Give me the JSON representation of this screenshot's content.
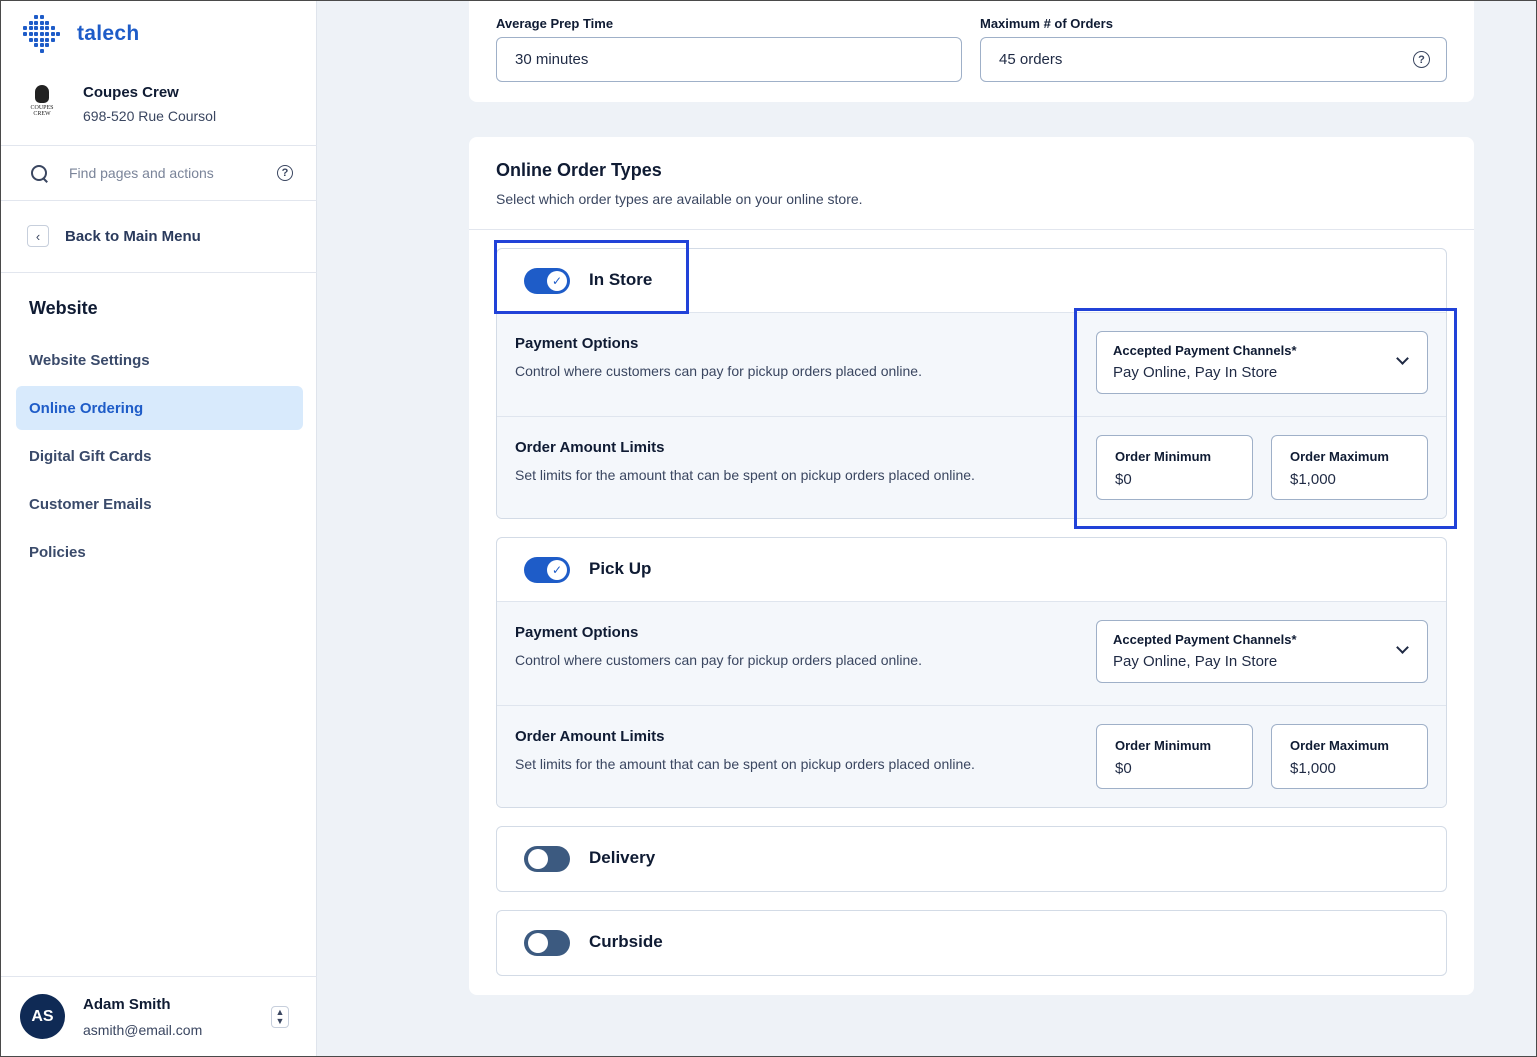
{
  "brand": {
    "name": "talech"
  },
  "store": {
    "name": "Coupes Crew",
    "address": "698-520 Rue Coursol",
    "logo_text": "COUPES CREW"
  },
  "search": {
    "placeholder": "Find pages and actions",
    "help_glyph": "?"
  },
  "back": {
    "label": "Back to Main Menu"
  },
  "section": {
    "title": "Website"
  },
  "nav": [
    {
      "label": "Website Settings",
      "active": false
    },
    {
      "label": "Online Ordering",
      "active": true
    },
    {
      "label": "Digital Gift Cards",
      "active": false
    },
    {
      "label": "Customer Emails",
      "active": false
    },
    {
      "label": "Policies",
      "active": false
    }
  ],
  "user": {
    "initials": "AS",
    "name": "Adam Smith",
    "email": "asmith@email.com"
  },
  "prep": {
    "avg_label": "Average Prep Time",
    "avg_value": "30 minutes",
    "max_label": "Maximum # of Orders",
    "max_value": "45 orders"
  },
  "order_types": {
    "title": "Online Order Types",
    "subtitle": "Select which order types are available on your online store.",
    "types": [
      {
        "name": "In Store",
        "enabled": true,
        "payment": {
          "title": "Payment Options",
          "desc": "Control where customers can pay for pickup orders placed online.",
          "select_label": "Accepted Payment Channels*",
          "select_value": "Pay Online, Pay In Store"
        },
        "limits": {
          "title": "Order Amount Limits",
          "desc": "Set limits for the amount that can be spent on pickup orders placed online.",
          "min_label": "Order Minimum",
          "min_value": "$0",
          "max_label": "Order Maximum",
          "max_value": "$1,000"
        }
      },
      {
        "name": "Pick Up",
        "enabled": true,
        "payment": {
          "title": "Payment Options",
          "desc": "Control where customers can pay for pickup orders placed online.",
          "select_label": "Accepted Payment Channels*",
          "select_value": "Pay Online, Pay In Store"
        },
        "limits": {
          "title": "Order Amount Limits",
          "desc": "Set limits for the amount that can be spent on pickup orders placed online.",
          "min_label": "Order Minimum",
          "min_value": "$0",
          "max_label": "Order Maximum",
          "max_value": "$1,000"
        }
      },
      {
        "name": "Delivery",
        "enabled": false
      },
      {
        "name": "Curbside",
        "enabled": false
      }
    ]
  },
  "glyphs": {
    "check": "✓",
    "back": "‹",
    "switch_up": "▲",
    "switch_down": "▼"
  },
  "colors": {
    "accent": "#1e5cc8",
    "highlight": "#2142d8",
    "active_nav_bg": "#d8eafc",
    "toggle_off": "#3c5a80"
  }
}
